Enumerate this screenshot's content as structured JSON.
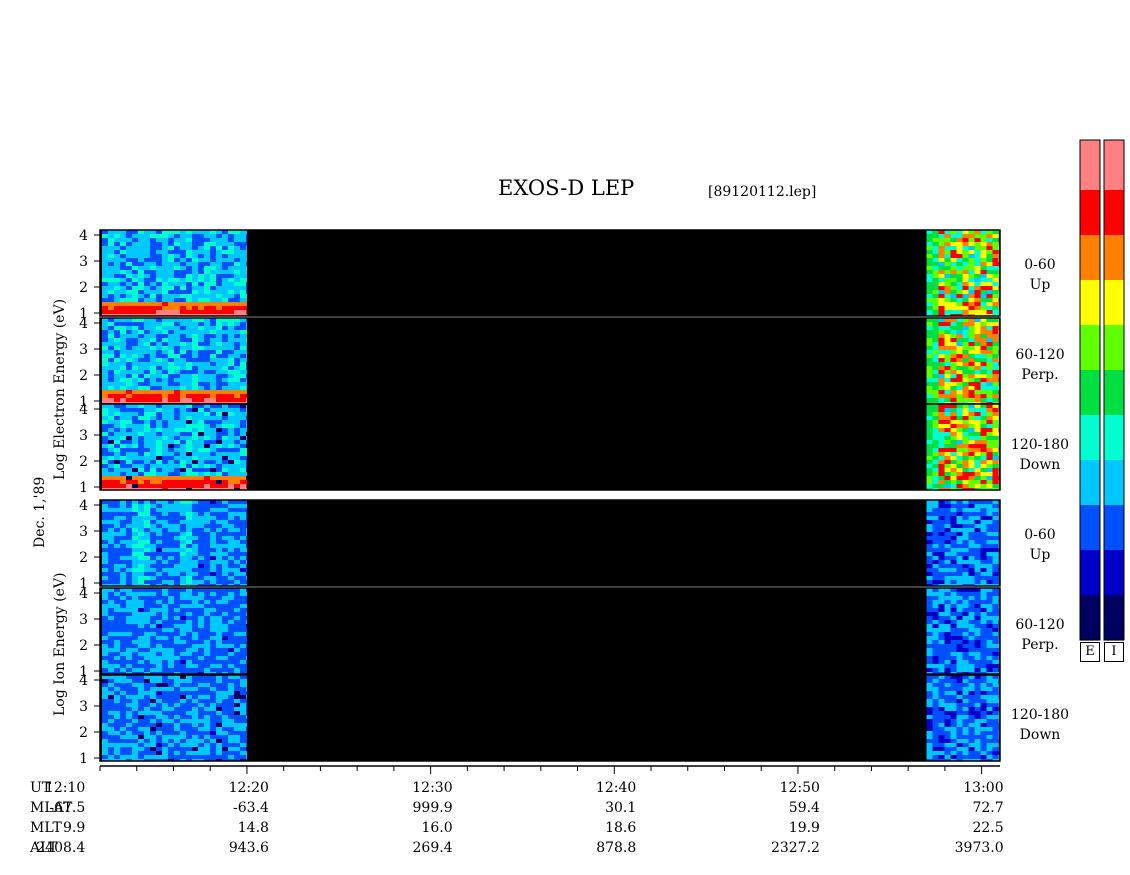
{
  "header": {
    "title": "EXOS-D LEP",
    "filename": "[89120112.lep]"
  },
  "date_label": "Dec. 1,'89",
  "panels": {
    "electron": {
      "ylabel": "Log  Electron  Energy  (eV)",
      "bands": [
        {
          "line1": "0-60",
          "line2": "Up"
        },
        {
          "line1": "60-120",
          "line2": "Perp."
        },
        {
          "line1": "120-180",
          "line2": "Down"
        }
      ]
    },
    "ion": {
      "ylabel": "Log  Ion  Energy  (eV)",
      "bands": [
        {
          "line1": "0-60",
          "line2": "Up"
        },
        {
          "line1": "60-120",
          "line2": "Perp."
        },
        {
          "line1": "120-180",
          "line2": "Down"
        }
      ]
    }
  },
  "colorbar": {
    "labels": [
      "E",
      "I"
    ]
  },
  "table": {
    "rows": [
      {
        "label": "UT",
        "values": [
          "12:10",
          "12:20",
          "12:30",
          "12:40",
          "12:50",
          "13:00"
        ]
      },
      {
        "label": "MLAT",
        "values": [
          "-67.5",
          "-63.4",
          "999.9",
          "30.1",
          "59.4",
          "72.7"
        ]
      },
      {
        "label": "MLT",
        "values": [
          "9.9",
          "14.8",
          "16.0",
          "18.6",
          "19.9",
          "22.5"
        ]
      },
      {
        "label": "ALT",
        "values": [
          "2408.4",
          "943.6",
          "269.4",
          "878.8",
          "2327.2",
          "3973.0"
        ]
      }
    ]
  },
  "chart_data": {
    "type": "heatmap",
    "title": "EXOS-D LEP",
    "xlabel": "UT",
    "x_tick_labels": [
      "12:10",
      "12:20",
      "12:30",
      "12:40",
      "12:50",
      "13:00"
    ],
    "x_range_minutes": [
      12.0,
      61.0
    ],
    "y_ticks": [
      "1",
      "2",
      "3",
      "4"
    ],
    "data_coverage": [
      {
        "from": "12:02",
        "to": "12:20"
      },
      {
        "from": "12:57",
        "to": "13:00"
      }
    ],
    "gap": {
      "from": "12:20",
      "to": "12:57",
      "color": "#000000"
    },
    "subpanels": [
      {
        "species": "Electron",
        "pitch": "0-60 Up"
      },
      {
        "species": "Electron",
        "pitch": "60-120 Perp."
      },
      {
        "species": "Electron",
        "pitch": "120-180 Down"
      },
      {
        "species": "Ion",
        "pitch": "0-60 Up"
      },
      {
        "species": "Ion",
        "pitch": "60-120 Perp."
      },
      {
        "species": "Ion",
        "pitch": "120-180 Down"
      }
    ],
    "colormap": [
      "#000060",
      "#0000c8",
      "#0050ff",
      "#00c8ff",
      "#00ffd0",
      "#00e040",
      "#60ff00",
      "#ffff00",
      "#ff8000",
      "#ff0000",
      "#ff8080",
      "#ffffff"
    ]
  }
}
